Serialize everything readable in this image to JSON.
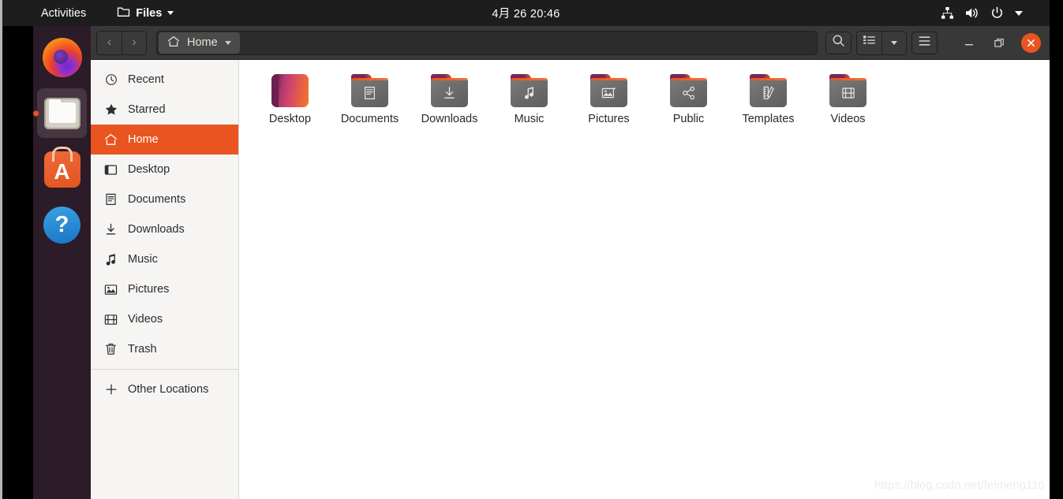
{
  "top_bar": {
    "activities": "Activities",
    "app_name": "Files",
    "app_icon": "folder-icon",
    "app_menu_caret": "chevron-down-icon",
    "clock": "4月 26 20:46",
    "status_icons": [
      "network-wired-icon",
      "volume-icon",
      "power-icon",
      "chevron-down-icon"
    ]
  },
  "dock": {
    "items": [
      {
        "name": "firefox",
        "label": "Firefox",
        "active": false
      },
      {
        "name": "files",
        "label": "Files",
        "active": true
      },
      {
        "name": "ubuntu-software",
        "label": "Ubuntu Software",
        "letter": "A",
        "active": false
      },
      {
        "name": "help",
        "label": "Help",
        "glyph": "?",
        "active": false
      }
    ]
  },
  "window": {
    "headerbar": {
      "back_label": "‹",
      "forward_label": "›",
      "breadcrumb": "Home",
      "breadcrumb_icon": "home-icon",
      "breadcrumb_caret": "chevron-down-icon",
      "search_icon": "search-icon",
      "view_list_icon": "list-view-icon",
      "view_caret_icon": "chevron-down-icon",
      "menu_icon": "hamburger-menu-icon",
      "minimize_label": "—",
      "maximize_label": "❐",
      "close_label": "✕"
    },
    "sidebar": {
      "items": [
        {
          "label": "Recent",
          "icon": "clock-icon",
          "selected": false
        },
        {
          "label": "Starred",
          "icon": "star-icon",
          "selected": false
        },
        {
          "label": "Home",
          "icon": "home-icon",
          "selected": true
        },
        {
          "label": "Desktop",
          "icon": "desktop-icon",
          "selected": false
        },
        {
          "label": "Documents",
          "icon": "document-icon",
          "selected": false
        },
        {
          "label": "Downloads",
          "icon": "download-icon",
          "selected": false
        },
        {
          "label": "Music",
          "icon": "music-note-icon",
          "selected": false
        },
        {
          "label": "Pictures",
          "icon": "image-icon",
          "selected": false
        },
        {
          "label": "Videos",
          "icon": "film-icon",
          "selected": false
        },
        {
          "label": "Trash",
          "icon": "trash-icon",
          "selected": false
        }
      ],
      "other_locations": {
        "label": "Other Locations",
        "icon": "plus-icon"
      }
    },
    "files": [
      {
        "label": "Desktop",
        "icon": "wallpaper-thumb"
      },
      {
        "label": "Documents",
        "icon": "folder-documents-icon"
      },
      {
        "label": "Downloads",
        "icon": "folder-downloads-icon"
      },
      {
        "label": "Music",
        "icon": "folder-music-icon"
      },
      {
        "label": "Pictures",
        "icon": "folder-pictures-icon"
      },
      {
        "label": "Public",
        "icon": "folder-public-icon"
      },
      {
        "label": "Templates",
        "icon": "folder-templates-icon"
      },
      {
        "label": "Videos",
        "icon": "folder-videos-icon"
      }
    ]
  },
  "watermark": "https://blog.csdn.net/feimeng116",
  "colors": {
    "ubuntu_orange": "#e95420",
    "aubergine": "#2c1b28",
    "headerbar": "#383838",
    "topbar": "#1d1d1d",
    "sidebar_bg": "#f6f5f4"
  }
}
